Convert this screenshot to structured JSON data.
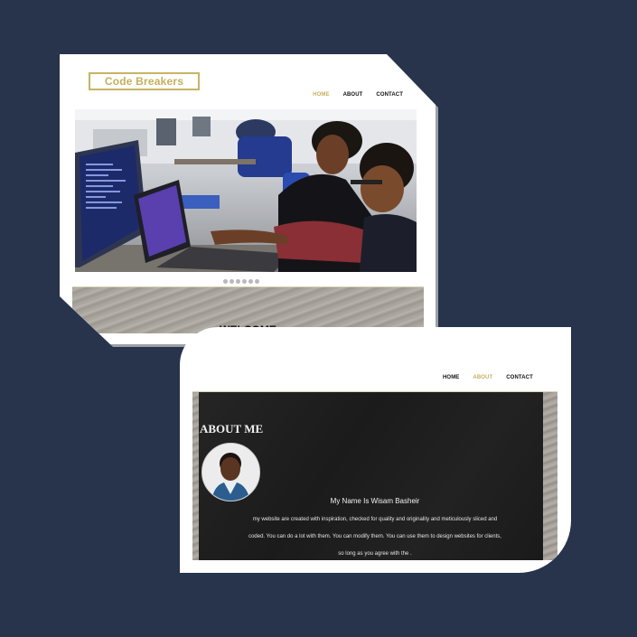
{
  "home": {
    "logo": "Code Breakers",
    "nav": [
      {
        "label": "HOME",
        "active": true
      },
      {
        "label": "ABOUT",
        "active": false
      },
      {
        "label": "CONTACT",
        "active": false
      }
    ],
    "hero_image": "office-team-at-computers-photo",
    "slider_dots": 6,
    "welcome": "WELCOME"
  },
  "about": {
    "nav": [
      {
        "label": "HOME",
        "active": false
      },
      {
        "label": "ABOUT",
        "active": true
      },
      {
        "label": "CONTACT",
        "active": false
      }
    ],
    "title": "ABOUT ME",
    "avatar": "profile-photo-avatar",
    "name": "My Name Is Wisam Basheir",
    "lines": [
      "my website are created with inspiration, checked for quality and originality and meticulously sliced and",
      "coded. You can do a lot with them. You can modify them. You can use them to design websites for clients,",
      "so long as you agree with the ."
    ]
  },
  "colors": {
    "background": "#27344c",
    "accent_gold": "#c3b05c",
    "card": "#ffffff"
  }
}
